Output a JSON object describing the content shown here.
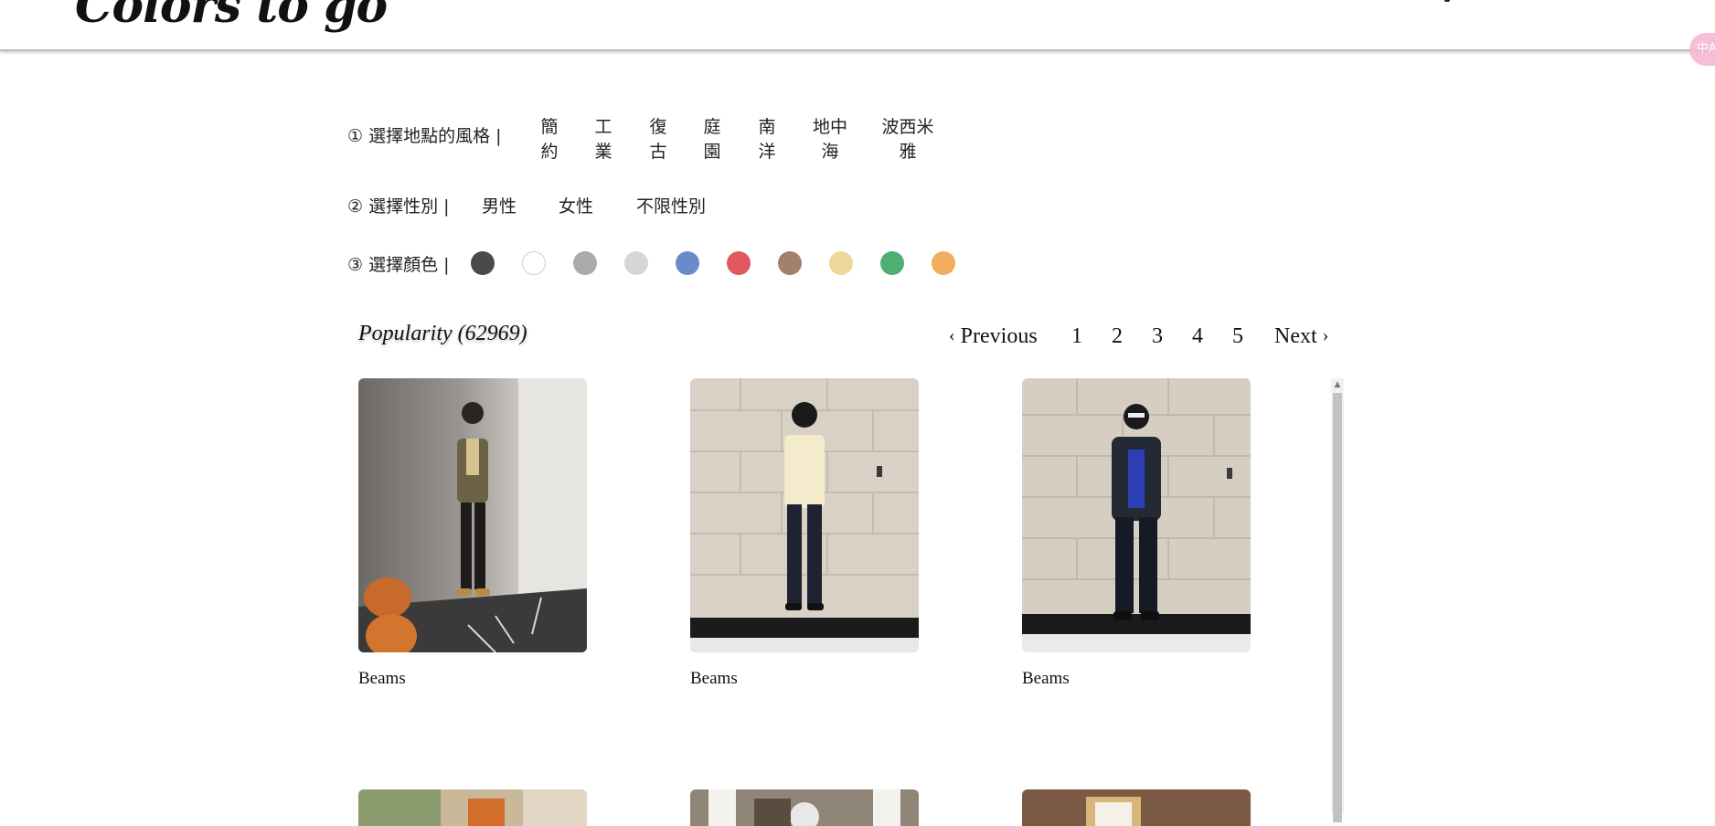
{
  "brand": {
    "logo_text": "Colors to go",
    "side_badge": "中A"
  },
  "filters": {
    "style": {
      "label": "① 選擇地點的風格 |",
      "options": [
        {
          "line1": "簡",
          "line2": "約"
        },
        {
          "line1": "工",
          "line2": "業"
        },
        {
          "line1": "復",
          "line2": "古"
        },
        {
          "line1": "庭",
          "line2": "園"
        },
        {
          "line1": "南",
          "line2": "洋"
        },
        {
          "line1": "地中",
          "line2": "海"
        },
        {
          "line1": "波西米",
          "line2": "雅"
        }
      ]
    },
    "gender": {
      "label": "② 選擇性別 |",
      "options": [
        "男性",
        "女性",
        "不限性別"
      ]
    },
    "color": {
      "label": "③ 選擇顏色 |",
      "swatches": [
        "#4a4a4a",
        "#ffffff",
        "#aaaaaa",
        "#d6d6d6",
        "#6b8ac9",
        "#e2585f",
        "#a3806a",
        "#ecd89a",
        "#4daf73",
        "#efaf5c"
      ]
    }
  },
  "listing": {
    "sort_title": "Popularity (62969)",
    "pagination": {
      "previous": "Previous",
      "pages": [
        "1",
        "2",
        "3",
        "4",
        "5"
      ],
      "next": "Next"
    },
    "items": [
      {
        "brand": "Beams"
      },
      {
        "brand": "Beams"
      },
      {
        "brand": "Beams"
      }
    ]
  }
}
